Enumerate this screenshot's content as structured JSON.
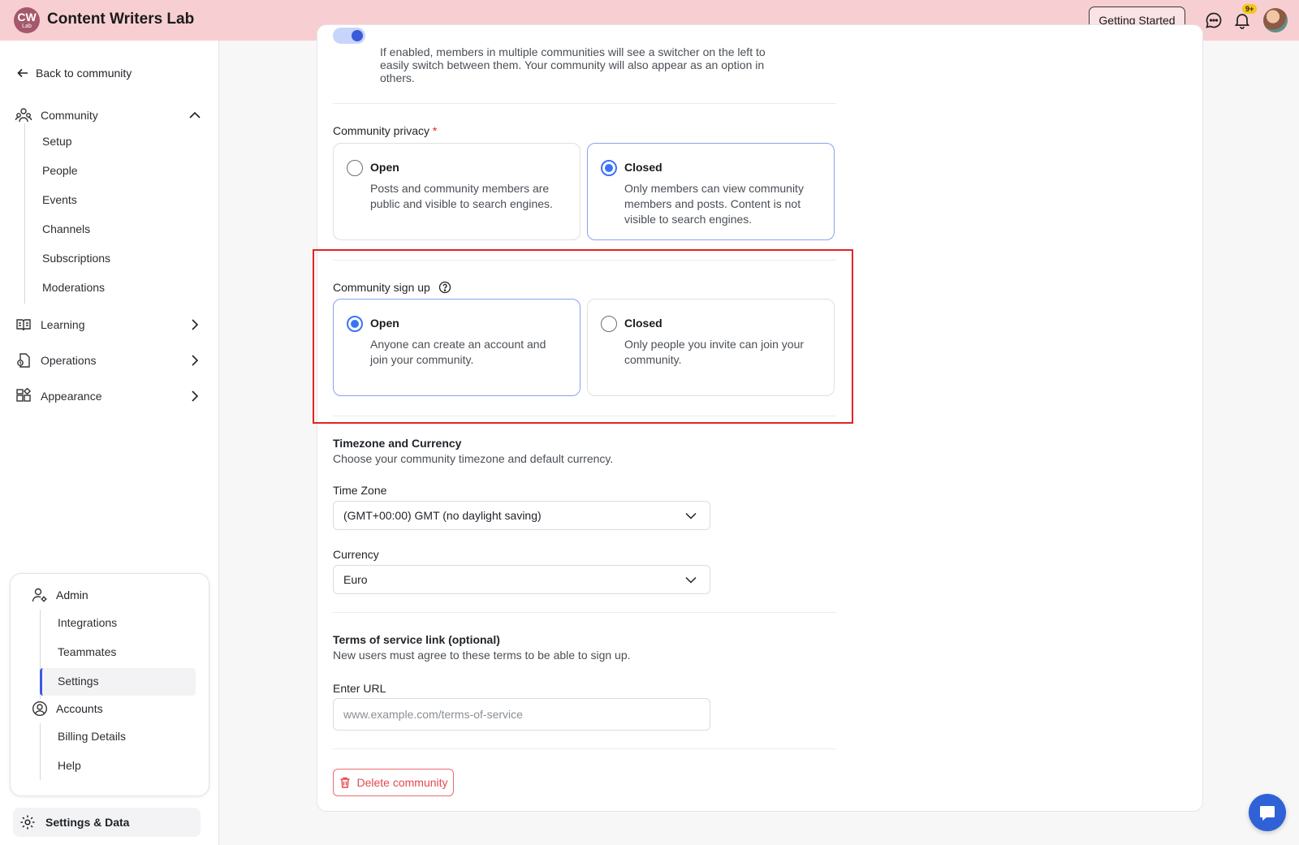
{
  "header": {
    "logo_line1": "CW",
    "logo_line2": "Lab",
    "app_title": "Content Writers Lab",
    "getting_started": "Getting Started",
    "notification_badge": "9+"
  },
  "sidebar": {
    "back": "Back to community",
    "community": "Community",
    "community_items": [
      "Setup",
      "People",
      "Events",
      "Channels",
      "Subscriptions",
      "Moderations"
    ],
    "learning": "Learning",
    "operations": "Operations",
    "appearance": "Appearance",
    "admin": {
      "title": "Admin",
      "items": [
        "Integrations",
        "Teammates",
        "Settings"
      ]
    },
    "accounts": {
      "title": "Accounts",
      "items": [
        "Billing Details",
        "Help"
      ]
    },
    "settings_data": "Settings & Data"
  },
  "main": {
    "switcher_desc": "If enabled, members in multiple communities will see a switcher on the left to easily switch between them. Your community will also appear as an option in others.",
    "privacy": {
      "label": "Community privacy",
      "required": "*",
      "open_title": "Open",
      "open_desc": "Posts and community members are public and visible to search engines.",
      "closed_title": "Closed",
      "closed_desc": "Only members can view community members and posts. Content is not visible to search engines.",
      "selected": "Closed"
    },
    "signup": {
      "label": "Community sign up",
      "open_title": "Open",
      "open_desc": "Anyone can create an account and join your community.",
      "closed_title": "Closed",
      "closed_desc": "Only people you invite can join your community.",
      "selected": "Open"
    },
    "tz_currency": {
      "title": "Timezone and Currency",
      "desc": "Choose your community timezone and default currency.",
      "timezone_label": "Time Zone",
      "timezone_value": "(GMT+00:00) GMT (no daylight saving)",
      "currency_label": "Currency",
      "currency_value": "Euro"
    },
    "terms": {
      "title": "Terms of service link (optional)",
      "desc": "New users must agree to these terms to be able to sign up.",
      "url_label": "Enter URL",
      "url_placeholder": "www.example.com/terms-of-service"
    },
    "delete_label": "Delete community"
  },
  "colors": {
    "topbar": "#f7cfd2",
    "accent": "#3b73f5",
    "highlight": "#e02424",
    "danger": "#e5484d"
  }
}
